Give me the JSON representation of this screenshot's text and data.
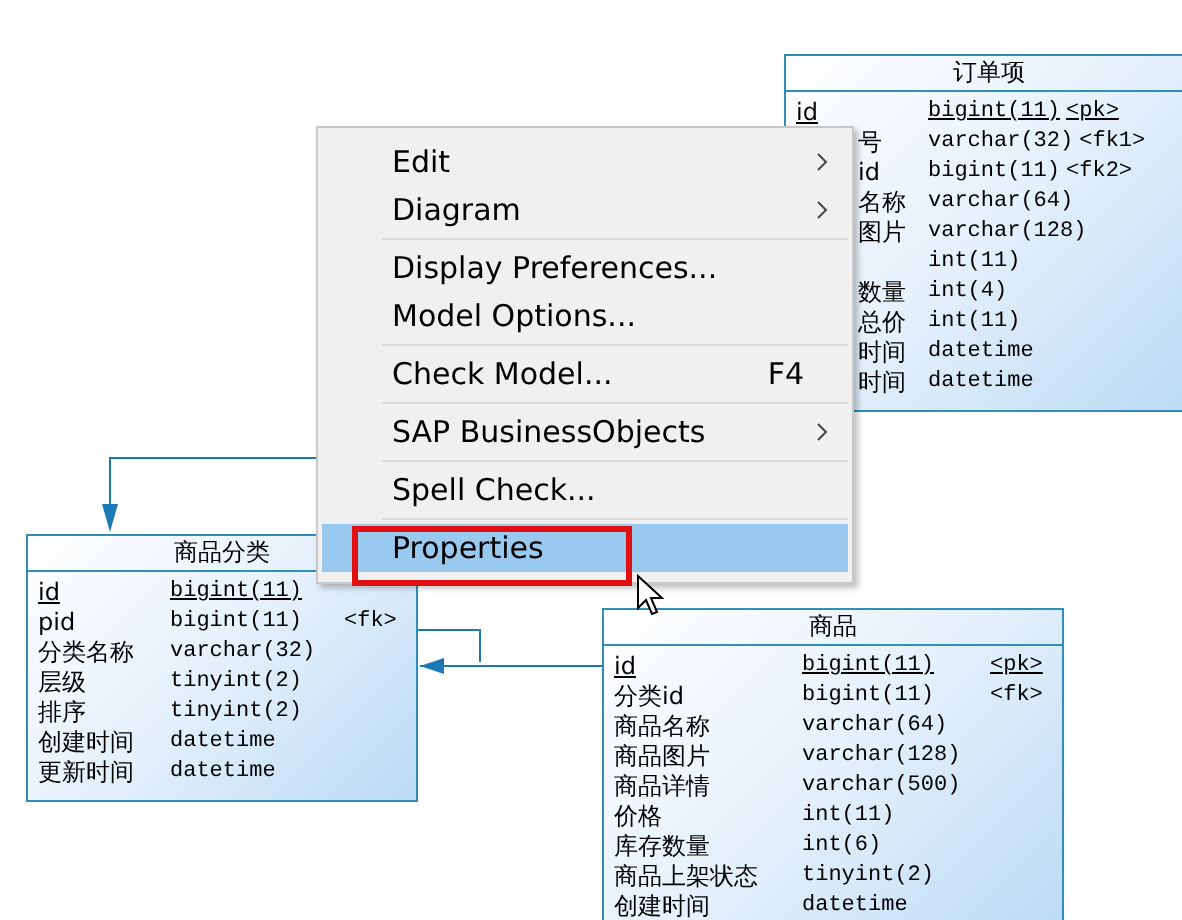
{
  "entities": [
    {
      "title": "订单项",
      "rows": [
        {
          "name": "id",
          "type": "bigint(11)",
          "key": "<pk>",
          "primary": true,
          "kind": "full"
        },
        {
          "name": "号",
          "type": "varchar(32)",
          "key": "<fk1>",
          "primary": false,
          "kind": "cut"
        },
        {
          "name": "id",
          "type": "bigint(11)",
          "key": "<fk2>",
          "primary": false,
          "kind": "cut"
        },
        {
          "name": "名称",
          "type": "varchar(64)",
          "primary": false,
          "kind": "cut"
        },
        {
          "name": "图片",
          "type": "varchar(128)",
          "primary": false,
          "kind": "cut"
        },
        {
          "type": "int(11)",
          "primary": false,
          "kind": "cut"
        },
        {
          "name": "数量",
          "type": "int(4)",
          "primary": false,
          "kind": "cut"
        },
        {
          "name": "总价",
          "type": "int(11)",
          "primary": false,
          "kind": "cut"
        },
        {
          "name": "时间",
          "type": "datetime",
          "primary": false,
          "kind": "cut"
        },
        {
          "name": "时间",
          "type": "datetime",
          "primary": false,
          "kind": "cut"
        }
      ]
    },
    {
      "title": "商品分类",
      "rows": [
        {
          "name": "id",
          "type": "bigint(11)",
          "primary": true,
          "kind": "full"
        },
        {
          "name": "pid",
          "type": "bigint(11)",
          "key": "<fk>",
          "primary": false,
          "kind": "full"
        },
        {
          "name": "分类名称",
          "type": "varchar(32)",
          "primary": false,
          "kind": "full"
        },
        {
          "name": "层级",
          "type": "tinyint(2)",
          "primary": false,
          "kind": "full"
        },
        {
          "name": "排序",
          "type": "tinyint(2)",
          "primary": false,
          "kind": "full"
        },
        {
          "name": "创建时间",
          "type": "datetime",
          "primary": false,
          "kind": "full"
        },
        {
          "name": "更新时间",
          "type": "datetime",
          "primary": false,
          "kind": "full"
        }
      ]
    },
    {
      "title": "商品",
      "rows": [
        {
          "name": "id",
          "type": "bigint(11)",
          "key": "<pk>",
          "primary": true,
          "kind": "full"
        },
        {
          "name": "分类id",
          "type": "bigint(11)",
          "key": "<fk>",
          "primary": false,
          "kind": "full"
        },
        {
          "name": "商品名称",
          "type": "varchar(64)",
          "primary": false,
          "kind": "full"
        },
        {
          "name": "商品图片",
          "type": "varchar(128)",
          "primary": false,
          "kind": "full"
        },
        {
          "name": "商品详情",
          "type": "varchar(500)",
          "primary": false,
          "kind": "full"
        },
        {
          "name": "价格",
          "type": "int(11)",
          "primary": false,
          "kind": "full"
        },
        {
          "name": "库存数量",
          "type": "int(6)",
          "primary": false,
          "kind": "full"
        },
        {
          "name": "商品上架状态",
          "type": "tinyint(2)",
          "primary": false,
          "kind": "full"
        },
        {
          "name": "创建时间",
          "type": "datetime",
          "primary": false,
          "kind": "full"
        }
      ]
    }
  ],
  "context_menu": {
    "groups": [
      [
        {
          "label": "Edit",
          "submenu": true,
          "selected": false,
          "outlined": false
        },
        {
          "label": "Diagram",
          "submenu": true,
          "selected": false,
          "outlined": false
        }
      ],
      [
        {
          "label": "Display Preferences...",
          "submenu": false,
          "selected": false,
          "outlined": false
        },
        {
          "label": "Model Options...",
          "submenu": false,
          "selected": false,
          "outlined": false
        }
      ],
      [
        {
          "label": "Check Model...",
          "shortcut": "F4",
          "submenu": false,
          "selected": false,
          "outlined": false
        }
      ],
      [
        {
          "label": "SAP BusinessObjects",
          "submenu": true,
          "selected": false,
          "outlined": false
        }
      ],
      [
        {
          "label": "Spell Check...",
          "submenu": false,
          "selected": false,
          "outlined": false
        }
      ],
      [
        {
          "label": "Properties",
          "submenu": false,
          "selected": true,
          "outlined": true
        }
      ]
    ]
  }
}
